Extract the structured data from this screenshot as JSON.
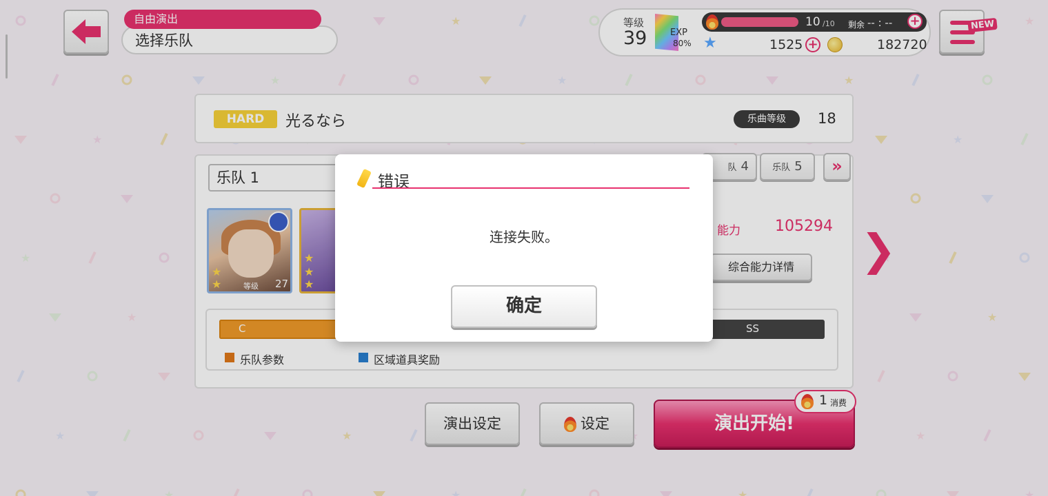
{
  "header": {
    "mode_label": "自由演出",
    "page_title": "选择乐队",
    "level_label": "等级",
    "level_value": "39",
    "exp_label": "EXP",
    "exp_percent": "80%",
    "stamina_current": "10",
    "stamina_max": "/10",
    "remaining_label": "剩余",
    "remaining_value": "-- : --",
    "stars": "1525",
    "coins": "182720",
    "new_badge": "NEW"
  },
  "song": {
    "difficulty": "HARD",
    "title": "光るなら",
    "level_label": "乐曲等级",
    "level": "18"
  },
  "band": {
    "selected": "乐队 1",
    "tabs": [
      {
        "label": "队",
        "num": "4"
      },
      {
        "label": "乐队",
        "num": "5"
      }
    ],
    "cards": [
      {
        "level_label": "等级",
        "level": "27"
      }
    ],
    "power_label": "能力",
    "power_value": "105294",
    "power_detail_button": "综合能力详情",
    "rank_start": "C",
    "rank_end": "SS",
    "legend": [
      {
        "label": "乐队参数",
        "color": "#e0781a"
      },
      {
        "label": "区域道具奖励",
        "color": "#2a7fd0"
      }
    ]
  },
  "buttons": {
    "performance_settings": "演出设定",
    "settings": "设定",
    "start": "演出开始!",
    "cost_num": "1",
    "cost_label": "消费"
  },
  "dialog": {
    "title": "错误",
    "message": "连接失败。",
    "ok": "确定"
  },
  "colors": {
    "accent": "#e8316e",
    "hard": "#f8d23a"
  }
}
